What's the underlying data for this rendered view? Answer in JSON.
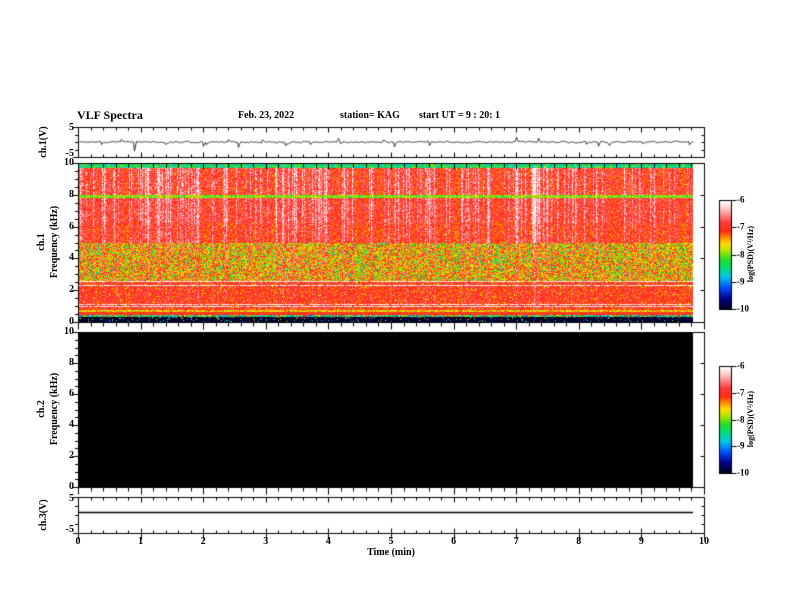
{
  "header": {
    "title": "VLF Spectra",
    "date": "Feb. 23, 2022",
    "station": "station= KAG",
    "start_ut": "start UT =  9 : 20: 1"
  },
  "axes": {
    "x_title": "Time (min)",
    "x_ticks": [
      "0",
      "1",
      "2",
      "3",
      "4",
      "5",
      "6",
      "7",
      "8",
      "9",
      "10"
    ],
    "x_minor_step_min": 0.2,
    "freq_ticks": [
      "10",
      "8",
      "6",
      "4",
      "2",
      "0"
    ],
    "volt_ticks": [
      "5",
      "-5"
    ],
    "colorbar_ticks": [
      "-6",
      "-7",
      "-8",
      "-9",
      "-10"
    ],
    "colorbar_label": "log(PSD)(V²/Hz)"
  },
  "panels": [
    {
      "id": "ch1-voltage",
      "label": "ch.1(V)"
    },
    {
      "id": "ch1-spectrogram",
      "label_ch": "ch.1",
      "label_axis": "Frequency (kHz)"
    },
    {
      "id": "ch2-spectrogram",
      "label_ch": "ch.2",
      "label_axis": "Frequency (kHz)"
    },
    {
      "id": "ch3-voltage",
      "label": "ch.3(V)"
    }
  ],
  "chart_data": [
    {
      "type": "line",
      "name": "ch.1 voltage waveform",
      "xlabel": "Time (min)",
      "xlim": [
        0,
        10
      ],
      "ylim": [
        -5,
        5
      ],
      "ytick_values": [
        5,
        -5
      ],
      "description": "continuous noisy black trace centered on 0 V, typical amplitude about ±1 V, with impulsive spikes",
      "noise_seed": 11,
      "noise_amp_v": 0.9,
      "spikes": [
        {
          "t": 0.89,
          "v": -3.0
        },
        {
          "t": 2.0,
          "v": -1.4
        },
        {
          "t": 2.55,
          "v": -1.8
        },
        {
          "t": 3.3,
          "v": -1.2
        },
        {
          "t": 4.15,
          "v": 1.2
        },
        {
          "t": 5.05,
          "v": -1.6
        },
        {
          "t": 5.6,
          "v": -1.2
        },
        {
          "t": 7.0,
          "v": 1.6
        },
        {
          "t": 7.35,
          "v": 1.3
        },
        {
          "t": 8.3,
          "v": -1.4
        },
        {
          "t": 9.85,
          "v": -3.8
        }
      ]
    },
    {
      "type": "heatmap",
      "name": "ch.1 VLF spectrogram",
      "xlim": [
        0,
        10
      ],
      "ylim_khz": [
        0,
        10
      ],
      "value_scale": "log(PSD)(V²/Hz)",
      "value_range": [
        -10,
        -6
      ],
      "data_end_min": 9.8,
      "noise_seed": 20220223,
      "colormap": [
        [
          0.0,
          [
            0,
            0,
            20
          ]
        ],
        [
          0.1,
          [
            0,
            0,
            140
          ]
        ],
        [
          0.2,
          [
            0,
            80,
            255
          ]
        ],
        [
          0.3,
          [
            0,
            200,
            230
          ]
        ],
        [
          0.38,
          [
            0,
            220,
            120
          ]
        ],
        [
          0.46,
          [
            40,
            220,
            40
          ]
        ],
        [
          0.54,
          [
            180,
            230,
            0
          ]
        ],
        [
          0.6,
          [
            255,
            220,
            0
          ]
        ],
        [
          0.66,
          [
            255,
            140,
            0
          ]
        ],
        [
          0.72,
          [
            255,
            40,
            20
          ]
        ],
        [
          0.8,
          [
            255,
            60,
            60
          ]
        ],
        [
          0.88,
          [
            255,
            150,
            150
          ]
        ],
        [
          0.94,
          [
            255,
            215,
            215
          ]
        ],
        [
          1.0,
          [
            255,
            255,
            255
          ]
        ]
      ],
      "bands": [
        {
          "f_lo": 9.8,
          "f_hi": 10.0,
          "style": "speckle-green-cyan"
        },
        {
          "f_lo": 8.05,
          "f_hi": 9.8,
          "style": "red-white-stripes-strong"
        },
        {
          "f_lo": 7.85,
          "f_hi": 8.05,
          "style": "green-yellow-line"
        },
        {
          "f_lo": 5.0,
          "f_hi": 7.85,
          "style": "red-white-stripes"
        },
        {
          "f_lo": 2.5,
          "f_hi": 5.0,
          "style": "red-yellow-green-mottle"
        },
        {
          "f_lo": 0.75,
          "f_hi": 2.5,
          "style": "dense-red"
        },
        {
          "f_lo": 0.58,
          "f_hi": 0.75,
          "style": "yellow-row"
        },
        {
          "f_lo": 0.44,
          "f_hi": 0.58,
          "style": "red-row"
        },
        {
          "f_lo": 0.3,
          "f_hi": 0.44,
          "style": "multicolor-speckle-row"
        },
        {
          "f_lo": 0.0,
          "f_hi": 0.3,
          "style": "black-with-dashes"
        }
      ],
      "white_lines_khz": [
        2.55,
        2.3,
        1.1,
        0.95
      ],
      "description": "dense red broadband noise with vertical white sferic stripes; green/cyan speckle at the 10 kHz edge; green horizontal line at 8 kHz; yellow-green mottling 2.5-5 kHz; layered red/yellow rows 0.3-0.8 kHz; black below 0.3 kHz with scattered green/blue/cyan marks"
    },
    {
      "type": "heatmap",
      "name": "ch.2 VLF spectrogram",
      "xlim": [
        0,
        10
      ],
      "ylim_khz": [
        0,
        10
      ],
      "value_scale": "log(PSD)(V²/Hz)",
      "value_range": [
        -10,
        -6
      ],
      "data_end_min": 9.8,
      "fill": "#000000",
      "description": "no signal - uniformly black panel"
    },
    {
      "type": "line",
      "name": "ch.3 voltage waveform",
      "xlim": [
        0,
        10
      ],
      "ylim": [
        -5,
        5
      ],
      "ytick_values": [
        5,
        -5
      ],
      "flat_value_v": 0.8,
      "description": "perfectly flat horizontal line slightly above 0 V"
    }
  ]
}
